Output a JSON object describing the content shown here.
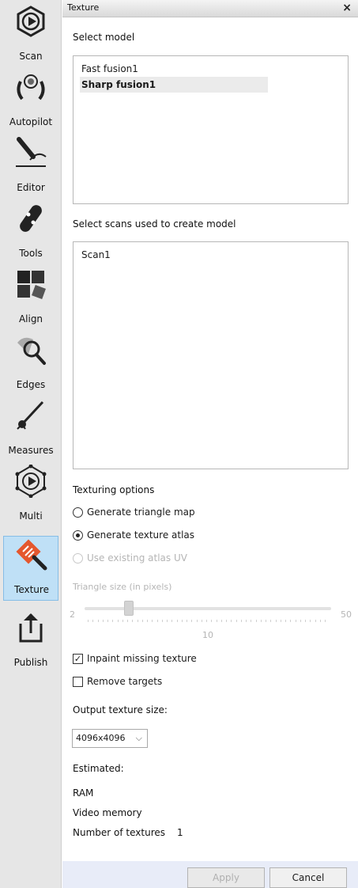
{
  "toolbar": [
    {
      "label": "Scan",
      "icon": "scan-icon",
      "active": false
    },
    {
      "label": "Autopilot",
      "icon": "autopilot-icon",
      "active": false
    },
    {
      "label": "Editor",
      "icon": "editor-icon",
      "active": false
    },
    {
      "label": "Tools",
      "icon": "tools-icon",
      "active": false
    },
    {
      "label": "Align",
      "icon": "align-icon",
      "active": false
    },
    {
      "label": "Edges",
      "icon": "edges-icon",
      "active": false
    },
    {
      "label": "Measures",
      "icon": "measures-icon",
      "active": false
    },
    {
      "label": "Multi",
      "icon": "multi-icon",
      "active": false
    },
    {
      "label": "Texture",
      "icon": "texture-icon",
      "active": true
    },
    {
      "label": "Publish",
      "icon": "publish-icon",
      "active": false
    }
  ],
  "panel": {
    "title": "Texture",
    "close_glyph": "×",
    "select_model_label": "Select model",
    "models": [
      {
        "name": "Fast fusion1",
        "selected": false
      },
      {
        "name": "Sharp fusion1",
        "selected": true
      }
    ],
    "select_scans_label": "Select scans used to create model",
    "scans": [
      "Scan1"
    ],
    "texturing_options_label": "Texturing options",
    "options": {
      "triangle_map": "Generate triangle map",
      "texture_atlas": "Generate texture atlas",
      "existing_atlas": "Use existing atlas UV"
    },
    "selected_option": "texture_atlas",
    "triangle_size_label": "Triangle size (in pixels)",
    "slider": {
      "min": "2",
      "max": "50",
      "value": "10"
    },
    "inpaint_label": "Inpaint missing texture",
    "inpaint_checked": true,
    "remove_targets_label": "Remove targets",
    "remove_targets_checked": false,
    "check_glyph": "✓",
    "output_size_label": "Output texture size:",
    "output_size_value": "4096x4096",
    "chevron": "⌵",
    "estimated_label": "Estimated:",
    "ram_label": "RAM",
    "video_memory_label": "Video memory",
    "num_textures_label": "Number of textures",
    "num_textures_value": "1",
    "apply_label": "Apply",
    "cancel_label": "Cancel"
  },
  "colors": {
    "active_tool_bg": "#bfe0f6",
    "footer_bg": "#e8ecf8",
    "texture_icon_accent": "#e4572e"
  }
}
